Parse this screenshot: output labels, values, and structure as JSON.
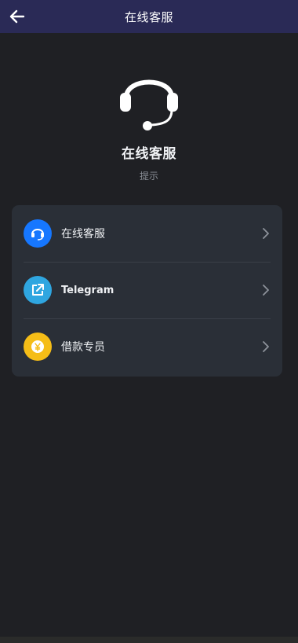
{
  "header": {
    "title": "在线客服",
    "back_icon": "arrow-left-icon"
  },
  "hero": {
    "icon": "headset-icon",
    "title": "在线客服",
    "subtitle": "提示"
  },
  "list": {
    "items": [
      {
        "label": "在线客服",
        "icon": "headset-icon",
        "icon_color": "#1677ff"
      },
      {
        "label": "Telegram",
        "icon": "external-link-icon",
        "icon_color": "#2fa6e0"
      },
      {
        "label": "借款专员",
        "icon": "yuan-coin-icon",
        "icon_color": "#f5bd17"
      }
    ]
  },
  "colors": {
    "header_bg": "#2a2a56",
    "page_bg": "#1f2024",
    "card_bg": "#2a2f37"
  }
}
